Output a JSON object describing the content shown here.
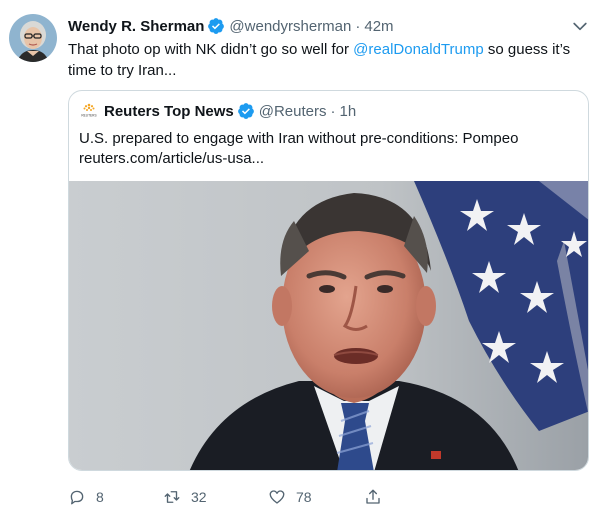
{
  "tweet": {
    "author": {
      "name": "Wendy R. Sherman",
      "handle": "@wendyrsherman",
      "verified": true
    },
    "time": "42m",
    "text": {
      "part1": "That photo op with NK didn’t go so well for ",
      "mention": "@realDonaldTrump",
      "part2": " so guess it’s time to try Iran..."
    },
    "quoted": {
      "author": {
        "name": "Reuters Top News",
        "handle": "@Reuters",
        "verified": true,
        "logo_text": "REUTERS"
      },
      "time": "1h",
      "text": "U.S. prepared to engage with Iran without pre-conditions: Pompeo",
      "link": "reuters.com/article/us-usa..."
    },
    "actions": {
      "replies": "8",
      "retweets": "32",
      "likes": "78"
    }
  },
  "icons": {
    "verified": "verified-badge-icon",
    "more": "chevron-down-icon",
    "reply": "reply-icon",
    "retweet": "retweet-icon",
    "like": "heart-icon",
    "share": "share-icon"
  },
  "colors": {
    "accent": "#1d9bf0",
    "text": "#0f1419",
    "muted": "#536471",
    "border": "#cfd9de"
  }
}
